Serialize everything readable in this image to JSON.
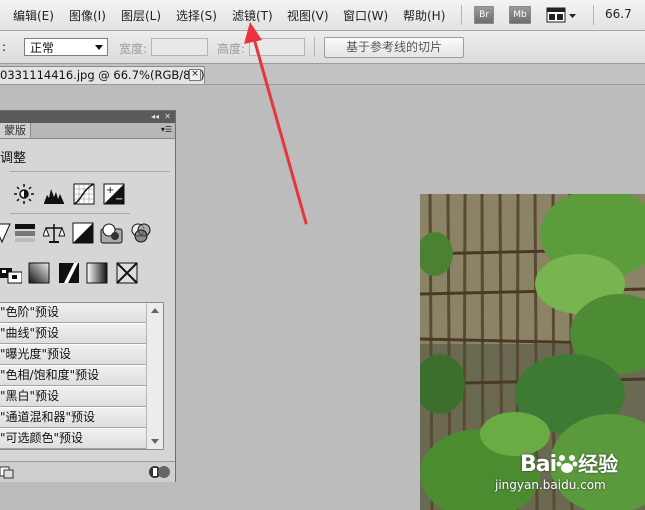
{
  "menubar": {
    "items": [
      "编辑(E)",
      "图像(I)",
      "图层(L)",
      "选择(S)",
      "滤镜(T)",
      "视图(V)",
      "窗口(W)",
      "帮助(H)"
    ],
    "br_label": "Br",
    "mb_label": "Mb",
    "zoom": "66.7"
  },
  "options": {
    "style_value": "正常",
    "width_label": "宽度:",
    "height_label": "高度:",
    "guide_button": "基于参考线的切片"
  },
  "document": {
    "tab_title": "0331114416.jpg @ 66.7%(RGB/8#) *"
  },
  "adjust_panel": {
    "tab_label": "蒙版",
    "title": "调整",
    "presets": [
      "\"色阶\"预设",
      "\"曲线\"预设",
      "\"曝光度\"预设",
      "\"色相/饱和度\"预设",
      "\"黑白\"预设",
      "\"通道混和器\"预设",
      "\"可选颜色\"预设"
    ]
  },
  "watermark": {
    "brand": "Bai",
    "suffix": "经验",
    "url": "jingyan.baidu.com"
  },
  "colors": {
    "annotation_arrow": "#e8343a"
  }
}
